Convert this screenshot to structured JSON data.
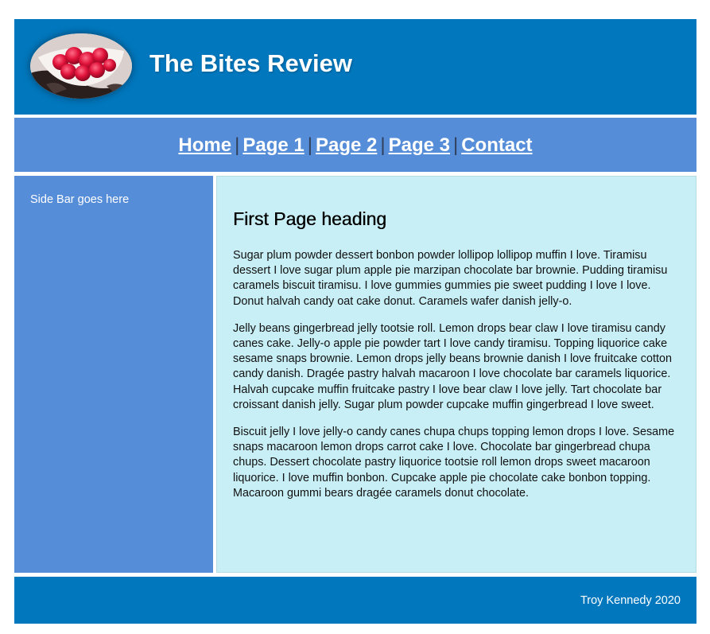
{
  "header": {
    "title": "The Bites Review",
    "logo_icon": "raspberries-bowl-icon"
  },
  "nav": {
    "links": [
      {
        "label": "Home"
      },
      {
        "label": "Page 1"
      },
      {
        "label": "Page 2"
      },
      {
        "label": "Page 3"
      },
      {
        "label": "Contact"
      }
    ],
    "separator": "|"
  },
  "sidebar": {
    "text": "Side Bar goes here"
  },
  "main": {
    "heading": "First Page heading",
    "paragraphs": [
      "Sugar plum powder dessert bonbon powder lollipop lollipop muffin I love. Tiramisu dessert I love sugar plum apple pie marzipan chocolate bar brownie. Pudding tiramisu caramels biscuit tiramisu. I love gummies gummies pie sweet pudding I love I love. Donut halvah candy oat cake donut. Caramels wafer danish jelly-o.",
      "Jelly beans gingerbread jelly tootsie roll. Lemon drops bear claw I love tiramisu candy canes cake. Jelly-o apple pie powder tart I love candy tiramisu. Topping liquorice cake sesame snaps brownie. Lemon drops jelly beans brownie danish I love fruitcake cotton candy danish. Dragée pastry halvah macaroon I love chocolate bar caramels liquorice. Halvah cupcake muffin fruitcake pastry I love bear claw I love jelly. Tart chocolate bar croissant danish jelly. Sugar plum powder cupcake muffin gingerbread I love sweet.",
      "Biscuit jelly I love jelly-o candy canes chupa chups topping lemon drops I love. Sesame snaps macaroon lemon drops carrot cake I love. Chocolate bar gingerbread chupa chups. Dessert chocolate pastry liquorice tootsie roll lemon drops sweet macaroon liquorice. I love muffin bonbon. Cupcake apple pie chocolate cake bonbon topping. Macaroon gummi bears dragée caramels donut chocolate."
    ]
  },
  "footer": {
    "text": "Troy Kennedy 2020"
  },
  "colors": {
    "header_bg": "#0177bd",
    "nav_bg": "#568dd9",
    "sidebar_bg": "#568dd9",
    "main_bg": "#c8eff6",
    "footer_bg": "#0177bd"
  }
}
